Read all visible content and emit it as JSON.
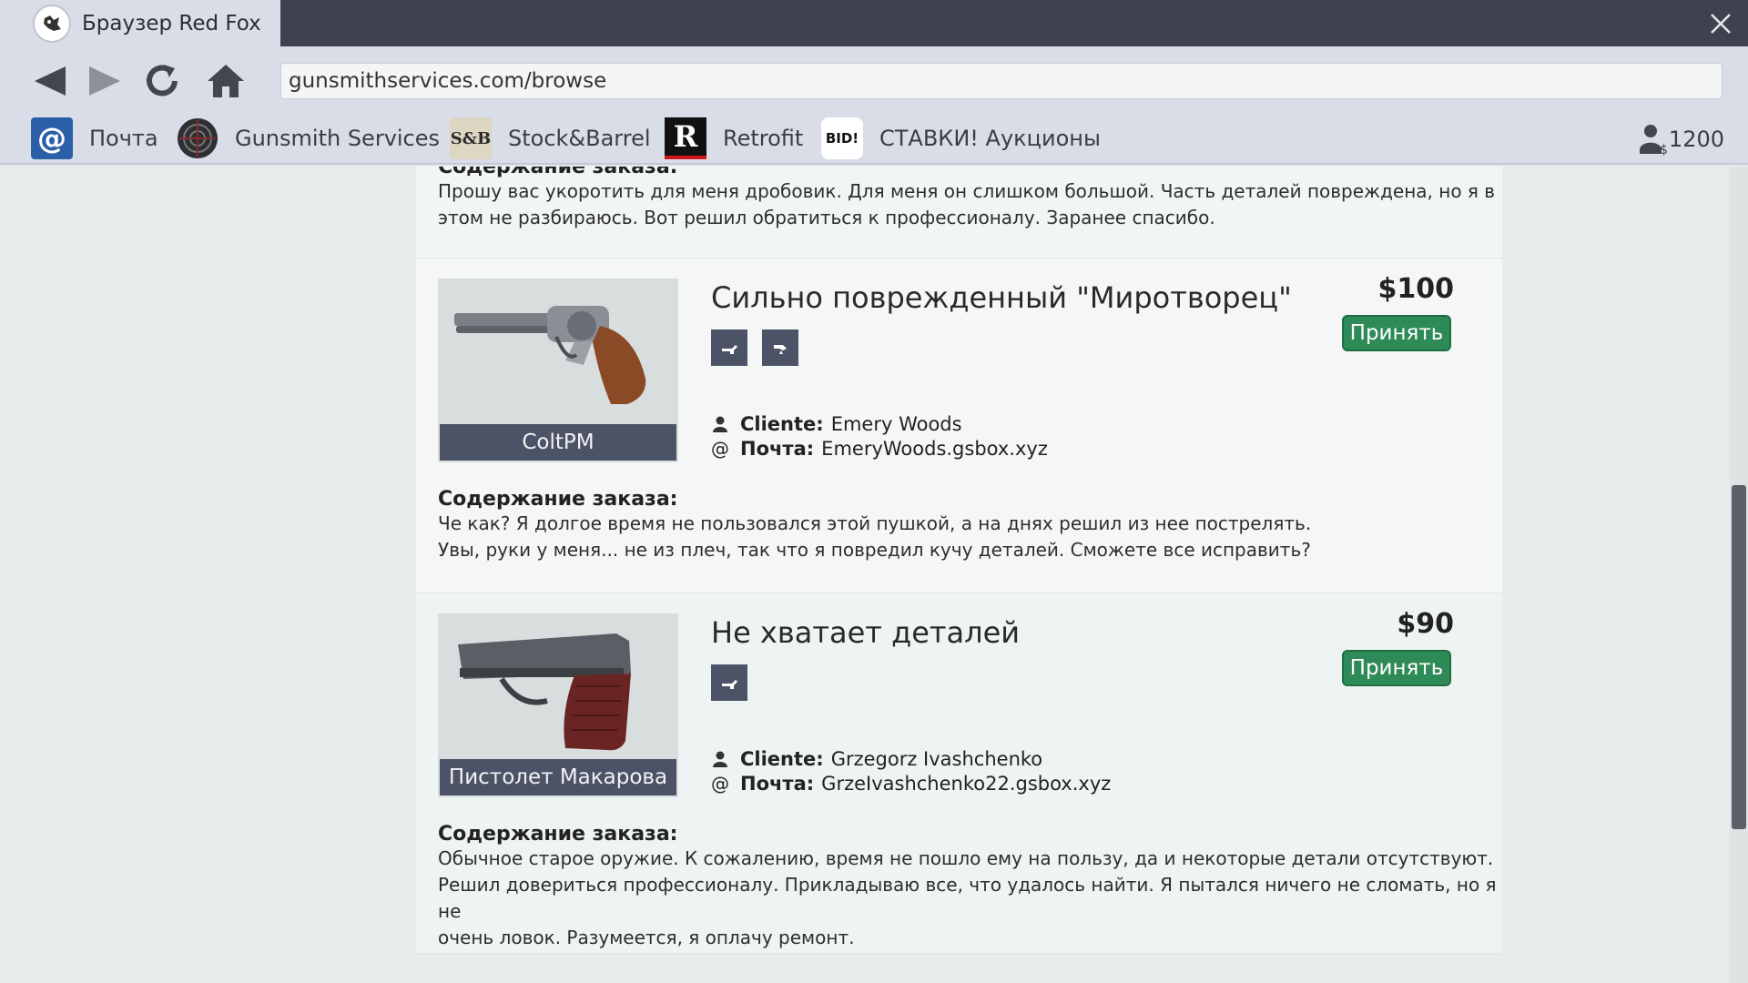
{
  "browser": {
    "tab_title": "Браузер Red Fox",
    "url": "gunsmithservices.com/browse"
  },
  "bookmarks": [
    {
      "label": "Почта",
      "icon": "mail-icon"
    },
    {
      "label": "Gunsmith Services",
      "icon": "gunsmith-icon"
    },
    {
      "label": "Stock&Barrel",
      "icon": "stock-barrel-icon",
      "icon_text": "S&B"
    },
    {
      "label": "Retrofit",
      "icon": "retrofit-icon",
      "icon_text": "R"
    },
    {
      "label": "СТАВКИ! Аукционы",
      "icon": "bid-icon",
      "icon_text": "BID!"
    }
  ],
  "balance": "1200",
  "orders": [
    {
      "desc_title": "Содержание заказа:",
      "desc_lines": [
        "Прошу вас укоротить для меня дробовик. Для меня он слишком большой. Часть деталей повреждена, но я в",
        "этом не разбираюсь. Вот решил обратиться к профессионалу. Заранее спасибо."
      ]
    },
    {
      "title": "Сильно поврежденный \"Миротворец\"",
      "weapon": "ColtPM",
      "price": "$100",
      "accept_label": "Принять",
      "client_label": "Cliente:",
      "client": "Emery Woods",
      "mail_label": "Почта:",
      "mail": "EmeryWoods.gsbox.xyz",
      "desc_title": "Содержание заказа:",
      "desc_lines": [
        "Че как? Я долгое время не пользовался этой пушкой, а на днях решил из нее пострелять.",
        "Увы, руки у меня... не из плеч, так что я повредил кучу деталей. Сможете все исправить?"
      ],
      "tools": [
        "repair-tool-icon",
        "disassemble-tool-icon"
      ]
    },
    {
      "title": "Не хватает деталей",
      "weapon": "Пистолет Макарова",
      "price": "$90",
      "accept_label": "Принять",
      "client_label": "Cliente:",
      "client": "Grzegorz Ivashchenko",
      "mail_label": "Почта:",
      "mail": "GrzeIvashchenko22.gsbox.xyz",
      "desc_title": "Содержание заказа:",
      "desc_lines": [
        "Обычное старое оружие. К сожалению, время не пошло ему на пользу, да и некоторые детали отсутствуют.",
        "Решил довериться профессионалу. Прикладываю все, что удалось найти. Я пытался ничего не сломать, но я не",
        "очень ловок. Разумеется, я оплачу ремонт."
      ],
      "tools": [
        "repair-tool-icon"
      ]
    }
  ],
  "colors": {
    "titlebar": "#3f414f",
    "toolbar": "#d9dde8",
    "accept": "#2e8a57",
    "label_bg": "#4d5367"
  }
}
